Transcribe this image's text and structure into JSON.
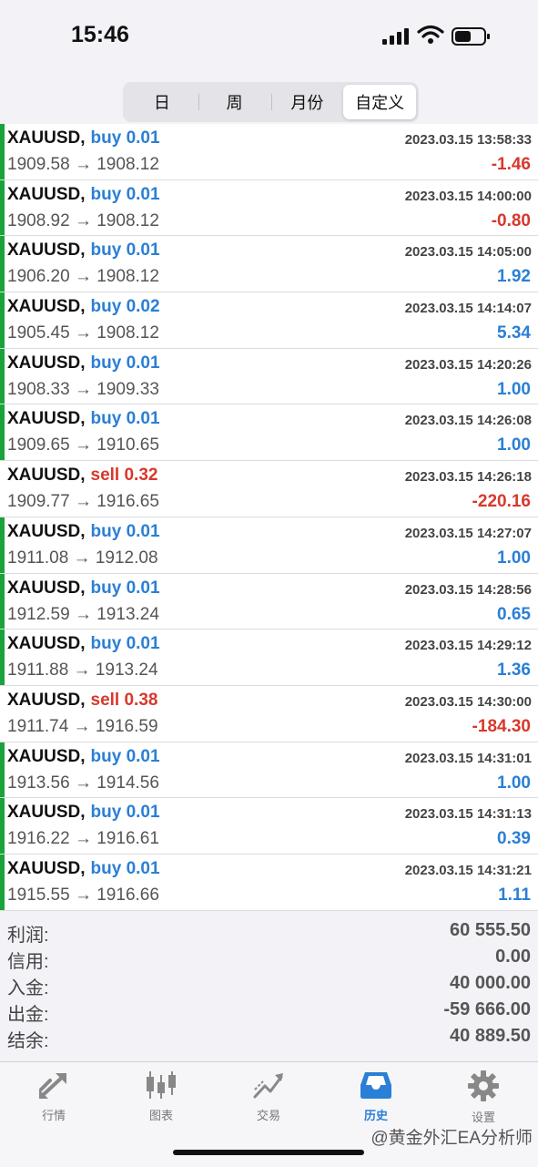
{
  "status": {
    "time": "15:46"
  },
  "tabs": {
    "day": "日",
    "week": "周",
    "month": "月份",
    "custom": "自定义"
  },
  "colors": {
    "buy": "#2a7fd6",
    "sell": "#d8382c",
    "accent_bar": "#1aa33a"
  },
  "trades": [
    {
      "symbol": "XAUUSD,",
      "side": "buy",
      "volume": "buy 0.01",
      "date": "2023.03.15 13:58:33",
      "prices": "1909.58 → 1908.12",
      "profit": "-1.46"
    },
    {
      "symbol": "XAUUSD,",
      "side": "buy",
      "volume": "buy 0.01",
      "date": "2023.03.15 14:00:00",
      "prices": "1908.92 → 1908.12",
      "profit": "-0.80"
    },
    {
      "symbol": "XAUUSD,",
      "side": "buy",
      "volume": "buy 0.01",
      "date": "2023.03.15 14:05:00",
      "prices": "1906.20 → 1908.12",
      "profit": "1.92"
    },
    {
      "symbol": "XAUUSD,",
      "side": "buy",
      "volume": "buy 0.02",
      "date": "2023.03.15 14:14:07",
      "prices": "1905.45 → 1908.12",
      "profit": "5.34"
    },
    {
      "symbol": "XAUUSD,",
      "side": "buy",
      "volume": "buy 0.01",
      "date": "2023.03.15 14:20:26",
      "prices": "1908.33 → 1909.33",
      "profit": "1.00"
    },
    {
      "symbol": "XAUUSD,",
      "side": "buy",
      "volume": "buy 0.01",
      "date": "2023.03.15 14:26:08",
      "prices": "1909.65 → 1910.65",
      "profit": "1.00"
    },
    {
      "symbol": "XAUUSD,",
      "side": "sell",
      "volume": "sell 0.32",
      "date": "2023.03.15 14:26:18",
      "prices": "1909.77 → 1916.65",
      "profit": "-220.16"
    },
    {
      "symbol": "XAUUSD,",
      "side": "buy",
      "volume": "buy 0.01",
      "date": "2023.03.15 14:27:07",
      "prices": "1911.08 → 1912.08",
      "profit": "1.00"
    },
    {
      "symbol": "XAUUSD,",
      "side": "buy",
      "volume": "buy 0.01",
      "date": "2023.03.15 14:28:56",
      "prices": "1912.59 → 1913.24",
      "profit": "0.65"
    },
    {
      "symbol": "XAUUSD,",
      "side": "buy",
      "volume": "buy 0.01",
      "date": "2023.03.15 14:29:12",
      "prices": "1911.88 → 1913.24",
      "profit": "1.36"
    },
    {
      "symbol": "XAUUSD,",
      "side": "sell",
      "volume": "sell 0.38",
      "date": "2023.03.15 14:30:00",
      "prices": "1911.74 → 1916.59",
      "profit": "-184.30"
    },
    {
      "symbol": "XAUUSD,",
      "side": "buy",
      "volume": "buy 0.01",
      "date": "2023.03.15 14:31:01",
      "prices": "1913.56 → 1914.56",
      "profit": "1.00"
    },
    {
      "symbol": "XAUUSD,",
      "side": "buy",
      "volume": "buy 0.01",
      "date": "2023.03.15 14:31:13",
      "prices": "1916.22 → 1916.61",
      "profit": "0.39"
    },
    {
      "symbol": "XAUUSD,",
      "side": "buy",
      "volume": "buy 0.01",
      "date": "2023.03.15 14:31:21",
      "prices": "1915.55 → 1916.66",
      "profit": "1.11"
    }
  ],
  "summary": [
    {
      "label": "利润:",
      "value": "60 555.50"
    },
    {
      "label": "信用:",
      "value": "0.00"
    },
    {
      "label": "入金:",
      "value": "40 000.00"
    },
    {
      "label": "出金:",
      "value": "-59 666.00"
    },
    {
      "label": "结余:",
      "value": "40 889.50"
    }
  ],
  "bottom_nav": {
    "quotes": {
      "label": "行情",
      "icon": "arrows-icon"
    },
    "charts": {
      "label": "图表",
      "icon": "candlestick-icon"
    },
    "trade": {
      "label": "交易",
      "icon": "trend-icon"
    },
    "history": {
      "label": "历史",
      "icon": "inbox-icon"
    },
    "settings": {
      "label": "设置",
      "icon": "gear-icon"
    }
  },
  "watermark": "@黄金外汇EA分析师"
}
